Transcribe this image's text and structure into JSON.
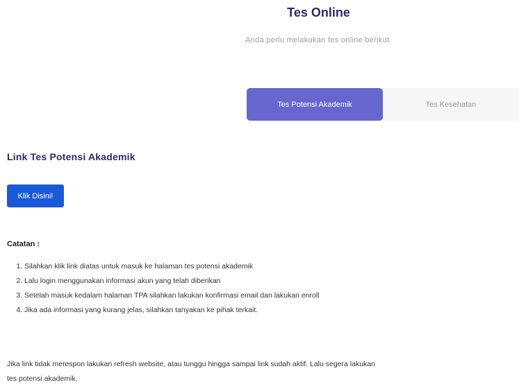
{
  "header": {
    "title": "Tes Online",
    "subtitle": "Anda perlu melakukan tes online berikut."
  },
  "tabs": [
    {
      "label": "Tes Potensi Akademik",
      "active": true
    },
    {
      "label": "Tes Kesehatan",
      "active": false
    }
  ],
  "content": {
    "section_title": "Link Tes Potensi Akademik",
    "button_label": "Klik Disini!",
    "notes_title": "Catatan :",
    "notes": [
      "Silahkan klik link diatas untuk masuk ke halaman tes potensi akademik",
      "Lalu login menggunakan informasi akun yang telah diberikan",
      "Setelah masuk kedalam halaman TPA silahkan lakukan konfirmasi email dan lakukan enroll",
      "Jika ada informasi yang kurang jelas, silahkan tanyakan ke pihak terkait."
    ],
    "footer": "Jika link tidak merespon lakukan refresh website, atau tunggu hingga sampai link sudah aktif. Lalu segera lakukan tes potensi akademik."
  },
  "colors": {
    "heading": "#2b2a6e",
    "tab_active": "#6766cf",
    "button": "#1a5ad9"
  }
}
